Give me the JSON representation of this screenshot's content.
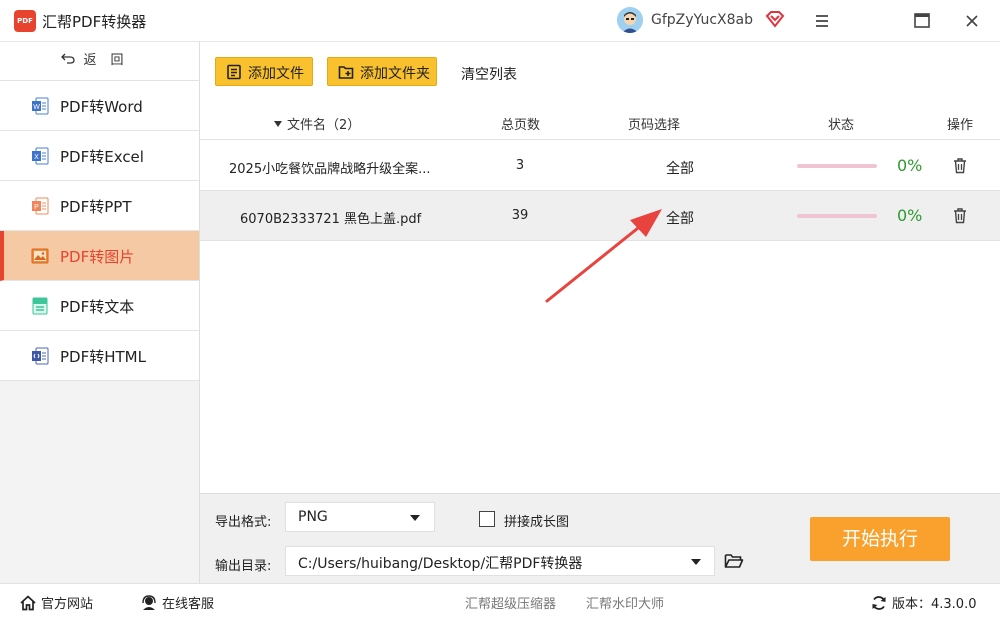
{
  "app": {
    "logo_text": "PDF",
    "title": "汇帮PDF转换器",
    "username": "GfpZyYucX8ab"
  },
  "sidebar": {
    "back_label": "返回",
    "items": [
      {
        "label": "PDF转Word",
        "icon": "word-icon",
        "active": false
      },
      {
        "label": "PDF转Excel",
        "icon": "excel-icon",
        "active": false
      },
      {
        "label": "PDF转PPT",
        "icon": "ppt-icon",
        "active": false
      },
      {
        "label": "PDF转图片",
        "icon": "image-icon",
        "active": true
      },
      {
        "label": "PDF转文本",
        "icon": "text-icon",
        "active": false
      },
      {
        "label": "PDF转HTML",
        "icon": "html-icon",
        "active": false
      }
    ]
  },
  "toolbar": {
    "add_file": "添加文件",
    "add_folder": "添加文件夹",
    "clear_list": "清空列表"
  },
  "table": {
    "headers": {
      "name": "文件名（2）",
      "pages": "总页数",
      "range": "页码选择",
      "status": "状态",
      "action": "操作"
    },
    "rows": [
      {
        "name": "2025小吃餐饮品牌战略升级全案...",
        "pages": "3",
        "range": "全部",
        "progress": 0,
        "percent": "0%"
      },
      {
        "name": "6070B2333721 黑色上盖.pdf",
        "pages": "39",
        "range": "全部",
        "progress": 0,
        "percent": "0%"
      }
    ]
  },
  "settings": {
    "format_label": "导出格式:",
    "format_value": "PNG",
    "stitch_label": "拼接成长图",
    "stitch_checked": false,
    "dir_label": "输出目录:",
    "dir_value": "C:/Users/huibang/Desktop/汇帮PDF转换器",
    "start_label": "开始执行"
  },
  "statusbar": {
    "site": "官方网站",
    "service": "在线客服",
    "compress": "汇帮超级压缩器",
    "watermark": "汇帮水印大师",
    "version": "版本：4.3.0.0"
  },
  "colors": {
    "accent": "#f9c12d",
    "active_bg": "#f5c9a3",
    "active_text": "#e8432f",
    "start_btn": "#f9a12c",
    "percent": "#2e9a2e",
    "annotation_arrow": "#e8433f"
  }
}
